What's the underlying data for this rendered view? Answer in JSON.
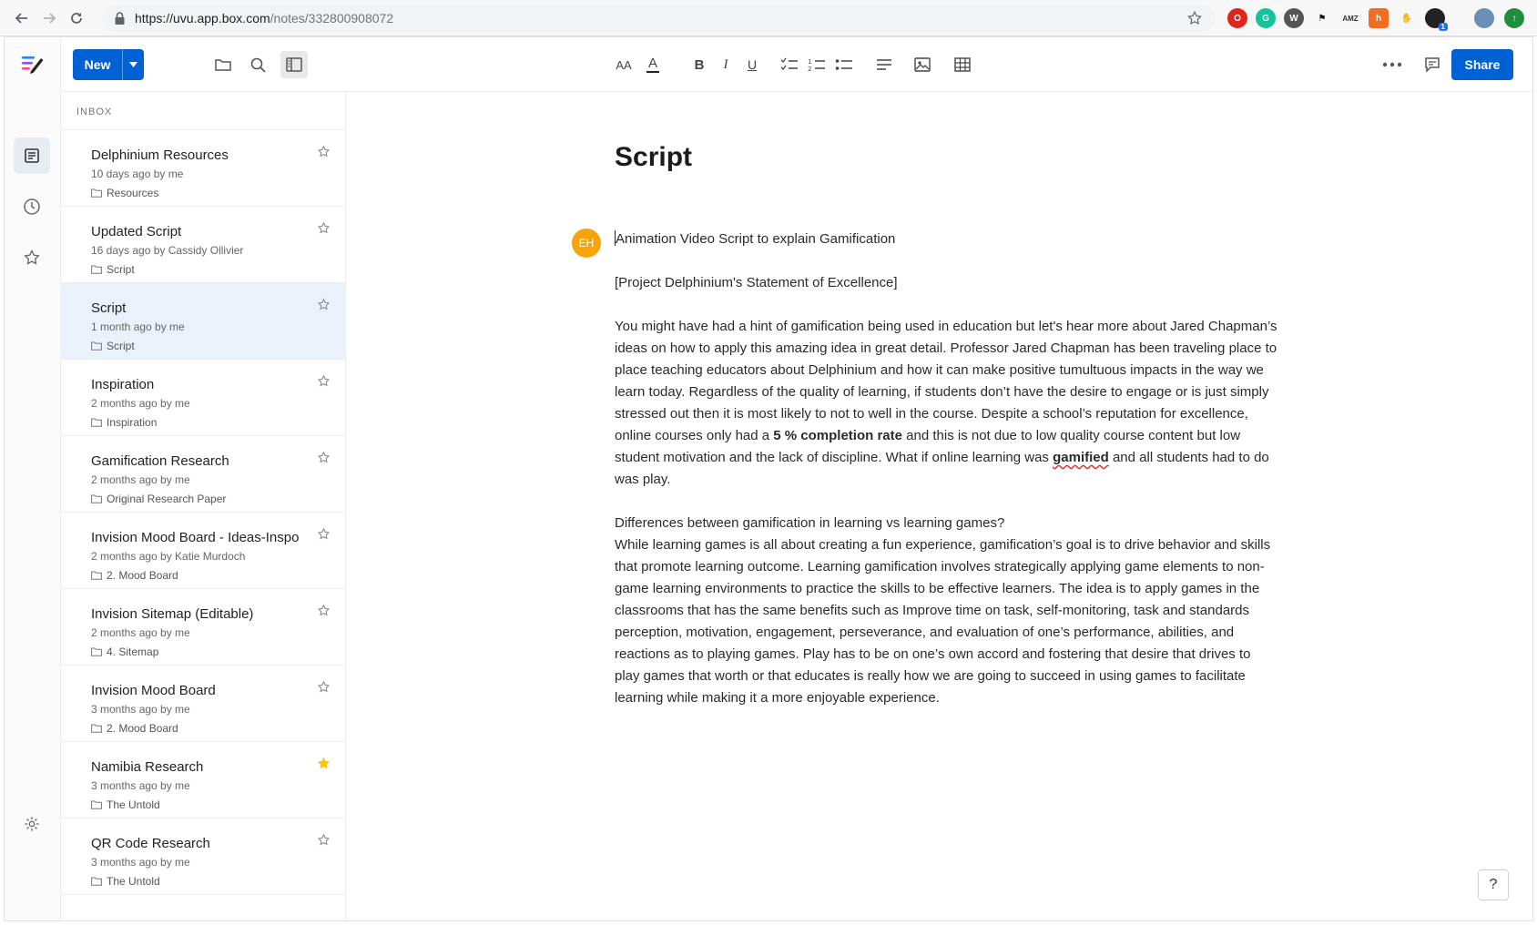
{
  "browser": {
    "url_host": "https://uvu.app.box.com",
    "url_path": "/notes/332800908072",
    "ext_badge": "1"
  },
  "toolbar": {
    "new_label": "New",
    "share_label": "Share",
    "font_size_label": "AA",
    "text_color_label": "A",
    "bold_label": "B",
    "italic_label": "I",
    "underline_label": "U"
  },
  "sidebar": {
    "section_label": "INBOX",
    "notes": [
      {
        "title": "Delphinium Resources",
        "meta": "10 days ago by me",
        "folder": "Resources",
        "starred": false
      },
      {
        "title": "Updated Script",
        "meta": "16 days ago by Cassidy Ollivier",
        "folder": "Script",
        "starred": false
      },
      {
        "title": "Script",
        "meta": "1 month ago by me",
        "folder": "Script",
        "starred": false
      },
      {
        "title": "Inspiration",
        "meta": "2 months ago by me",
        "folder": "Inspiration",
        "starred": false
      },
      {
        "title": "Gamification Research",
        "meta": "2 months ago by me",
        "folder": "Original Research Paper",
        "starred": false
      },
      {
        "title": "Invision Mood Board - Ideas-Inspo",
        "meta": "2 months ago by Katie Murdoch",
        "folder": "2. Mood Board",
        "starred": false
      },
      {
        "title": "Invision Sitemap (Editable)",
        "meta": "2 months ago by me",
        "folder": "4. Sitemap",
        "starred": false
      },
      {
        "title": "Invision Mood Board",
        "meta": "3 months ago by me",
        "folder": "2. Mood Board",
        "starred": false
      },
      {
        "title": "Namibia Research",
        "meta": "3 months ago by me",
        "folder": "The Untold",
        "starred": true
      },
      {
        "title": "QR Code Research",
        "meta": "3 months ago by me",
        "folder": "The Untold",
        "starred": false
      }
    ]
  },
  "document": {
    "title": "Script",
    "avatar_initials": "EH",
    "line1": "Animation Video Script to explain Gamification",
    "line2": "[Project Delphinium's Statement of Excellence]",
    "p1_a": "You might have had a hint of gamification being used in education but let's hear more about Jared Chapman’s ideas on how to apply this amazing idea in great detail. Professor Jared Chapman has been traveling place to place teaching educators about Delphinium and how it can make positive tumultuous impacts in the way we learn today. Regardless of the quality of learning, if students don’t have the desire to engage or is just simply stressed out then it is most likely to not to well in the course. Despite a school’s reputation for excellence, online courses only had a ",
    "p1_bold": "5 % completion rate",
    "p1_b": " and this is not due to low quality course content but  low student motivation  and the lack of discipline. What if online learning was ",
    "p1_spell": "gamified",
    "p1_c": " and all students had to do was play.",
    "p2_heading": "Differences between gamification in learning vs learning games?",
    "p2_body": "While learning games is all about creating a fun experience, gamification’s goal is to drive behavior and skills that promote learning outcome. Learning gamification involves strategically applying game elements to non-game learning environments to practice the skills to be effective learners. The idea is to apply games in the classrooms that has the same benefits such as Improve time on task, self-monitoring, task and standards perception, motivation, engagement, perseverance, and evaluation of one’s performance, abilities, and reactions as to playing games. Play has to be on one’s own accord and fostering that desire that drives to play games that worth or that educates is really how we are going to succeed in using games to facilitate learning while making it a more enjoyable experience."
  },
  "help_label": "?",
  "colors": {
    "accent": "#0061d5",
    "avatar": "#f7a40a",
    "selected_row": "#e9f2fb",
    "star_active": "#f5c518"
  }
}
